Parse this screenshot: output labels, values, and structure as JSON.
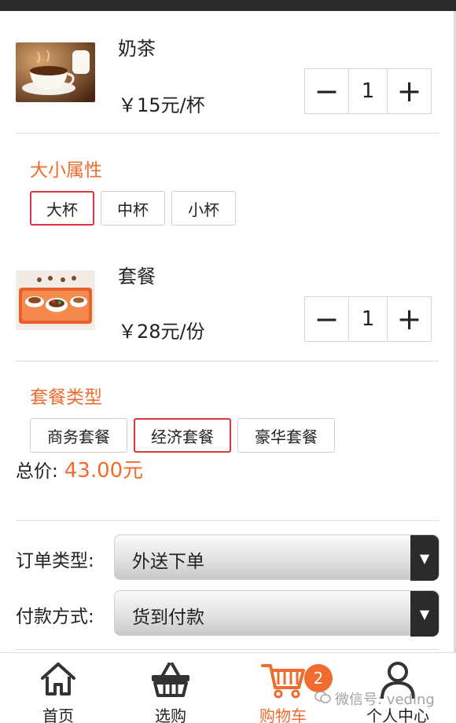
{
  "products": [
    {
      "name": "奶茶",
      "price": "￥15元/杯",
      "image_icon": "coffee-cup-photo",
      "quantity": "1",
      "minus_label": "−",
      "plus_label": "+",
      "attribute_title": "大小属性",
      "options": [
        "大杯",
        "中杯",
        "小杯"
      ],
      "selected_option": "大杯"
    },
    {
      "name": "套餐",
      "price": "￥28元/份",
      "image_icon": "meal-set-photo",
      "quantity": "1",
      "minus_label": "−",
      "plus_label": "+",
      "attribute_title": "套餐类型",
      "options": [
        "商务套餐",
        "经济套餐",
        "豪华套餐"
      ],
      "selected_option": "经济套餐"
    }
  ],
  "total": {
    "label": "总价:",
    "value": "43.00元"
  },
  "order_form": {
    "order_type_label": "订单类型:",
    "order_type_value": "外送下单",
    "payment_label": "付款方式:",
    "payment_value": "货到付款"
  },
  "tabbar": {
    "tabs": [
      {
        "label": "首页",
        "icon": "home-icon"
      },
      {
        "label": "选购",
        "icon": "basket-icon"
      },
      {
        "label": "购物车",
        "icon": "cart-icon",
        "badge": "2",
        "active": true
      },
      {
        "label": "个人中心",
        "icon": "person-icon"
      }
    ]
  },
  "watermark": "微信号: veding",
  "colors": {
    "accent": "#f06b2d",
    "selected_border": "#d9363e",
    "select_arrow_bg": "#2b2b2b"
  }
}
